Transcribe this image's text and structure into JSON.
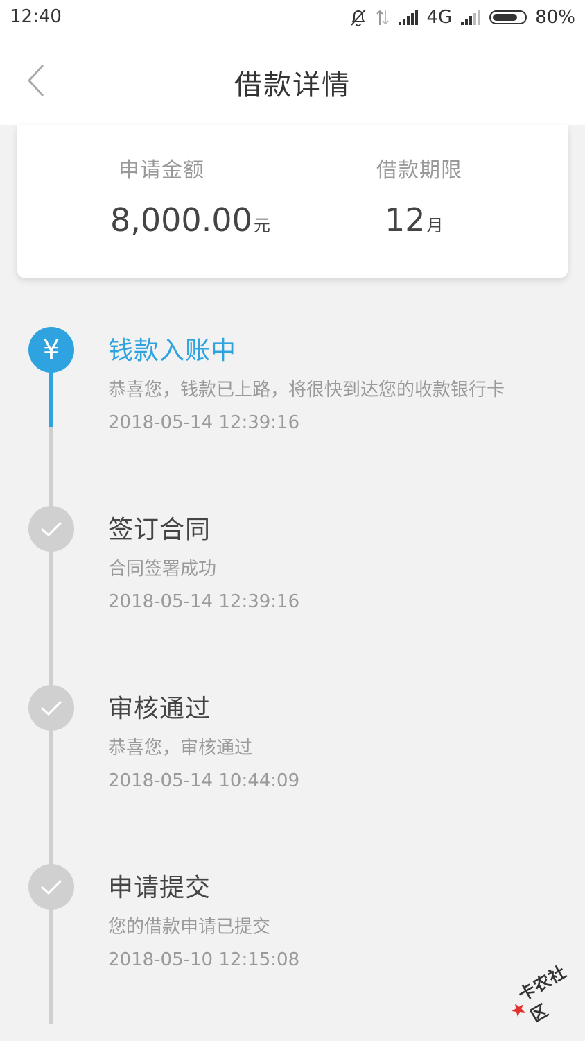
{
  "status_bar": {
    "time": "12:40",
    "network": "4G",
    "battery_percent": "80%",
    "battery_level": 0.8,
    "icons": [
      "bell-off-icon",
      "data-arrows-icon",
      "signal-icon",
      "signal-weak-icon",
      "battery-icon"
    ]
  },
  "nav": {
    "title": "借款详情",
    "back_icon": "chevron-left-icon"
  },
  "summary": {
    "amount_label": "申请金额",
    "amount_value": "8,000.00",
    "amount_unit": "元",
    "term_label": "借款期限",
    "term_value": "12",
    "term_unit": "月"
  },
  "timeline": {
    "steps": [
      {
        "title": "钱款入账中",
        "desc": "恭喜您，钱款已上路，将很快到达您的收款银行卡",
        "time": "2018-05-14 12:39:16",
        "state": "active",
        "icon": "yen-icon"
      },
      {
        "title": "签订合同",
        "desc": "合同签署成功",
        "time": "2018-05-14 12:39:16",
        "state": "done",
        "icon": "check-icon"
      },
      {
        "title": "审核通过",
        "desc": "恭喜您，审核通过",
        "time": "2018-05-14 10:44:09",
        "state": "done",
        "icon": "check-icon"
      },
      {
        "title": "申请提交",
        "desc": "您的借款申请已提交",
        "time": "2018-05-10 12:15:08",
        "state": "done",
        "icon": "check-icon"
      }
    ],
    "active_icon_glyph": "¥"
  },
  "watermark": {
    "text": "卡农社区"
  },
  "colors": {
    "accent": "#2ea3e0",
    "done_gray": "#d0d0d0",
    "line_gray": "#cfcfcf",
    "background": "#f2f2f2"
  }
}
